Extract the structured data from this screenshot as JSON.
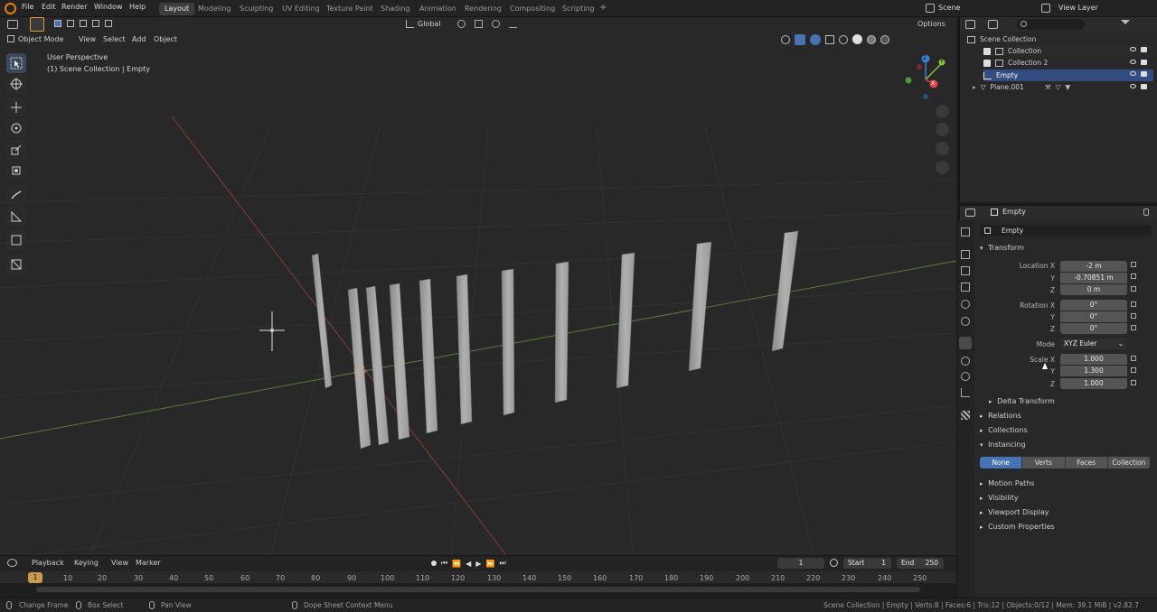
{
  "topbar": {
    "menus": [
      "File",
      "Edit",
      "Render",
      "Window",
      "Help"
    ],
    "workspaces": [
      "Layout",
      "Modeling",
      "Sculpting",
      "UV Editing",
      "Texture Paint",
      "Shading",
      "Animation",
      "Rendering",
      "Compositing",
      "Scripting"
    ],
    "active_workspace": "Layout",
    "add_tab": "+",
    "scene_label": "Scene",
    "view_layer_label": "View Layer"
  },
  "viewport_header": {
    "mode": "Object Mode",
    "menus": [
      "View",
      "Select",
      "Add",
      "Object"
    ],
    "transform_orientation": "Global",
    "options": "Options"
  },
  "viewport": {
    "perspective": "User Perspective",
    "context": "(1) Scene Collection | Empty",
    "gizmo": {
      "x": "X",
      "y": "Y",
      "z": "Z"
    }
  },
  "outliner": {
    "rows": [
      {
        "label": "Scene Collection"
      },
      {
        "label": "Collection"
      },
      {
        "label": "Collection 2"
      },
      {
        "label": "Empty"
      },
      {
        "label": "Plane.001"
      }
    ]
  },
  "properties": {
    "object_name_header": "Empty",
    "object_name_field": "Empty",
    "transform_title": "Transform",
    "location": {
      "label_x": "Location X",
      "label_y": "Y",
      "label_z": "Z",
      "x": "-2 m",
      "y": "-0.70851 m",
      "z": "0 m"
    },
    "rotation": {
      "label_x": "Rotation X",
      "label_y": "Y",
      "label_z": "Z",
      "x": "0°",
      "y": "0°",
      "z": "0°"
    },
    "mode_label": "Mode",
    "mode_value": "XYZ Euler",
    "scale": {
      "label_x": "Scale X",
      "label_y": "Y",
      "label_z": "Z",
      "x": "1.000",
      "y": "1.300",
      "z": "1.000"
    },
    "delta_transform": "Delta Transform",
    "relations": "Relations",
    "collections": "Collections",
    "instancing": "Instancing",
    "instancing_options": [
      "None",
      "Verts",
      "Faces",
      "Collection"
    ],
    "instancing_selected": "None",
    "motion_paths": "Motion Paths",
    "visibility": "Visibility",
    "viewport_display": "Viewport Display",
    "custom_properties": "Custom Properties"
  },
  "timeline": {
    "menus": [
      "Playback",
      "Keying",
      "View",
      "Marker"
    ],
    "current_frame": "1",
    "start_label": "Start",
    "start": "1",
    "end_label": "End",
    "end": "250",
    "ticks": [
      "10",
      "20",
      "30",
      "40",
      "50",
      "60",
      "70",
      "80",
      "90",
      "100",
      "110",
      "120",
      "130",
      "140",
      "150",
      "160",
      "170",
      "180",
      "190",
      "200",
      "210",
      "220",
      "230",
      "240",
      "250"
    ],
    "playhead": "1"
  },
  "statusbar": {
    "change_frame": "Change Frame",
    "box_select": "Box Select",
    "pan_view": "Pan View",
    "context_menu": "Dope Sheet Context Menu",
    "stats": "Scene Collection | Empty | Verts:8 | Faces:6 | Tris:12 | Objects:0/12 | Mem: 39.1 MiB | v2.82.7"
  },
  "colors": {
    "accent_blue": "#4772b3",
    "timeline_playhead": "#c79a4c",
    "axis_x": "#e2424b",
    "axis_y": "#82c440",
    "axis_z": "#3b7fd6"
  }
}
